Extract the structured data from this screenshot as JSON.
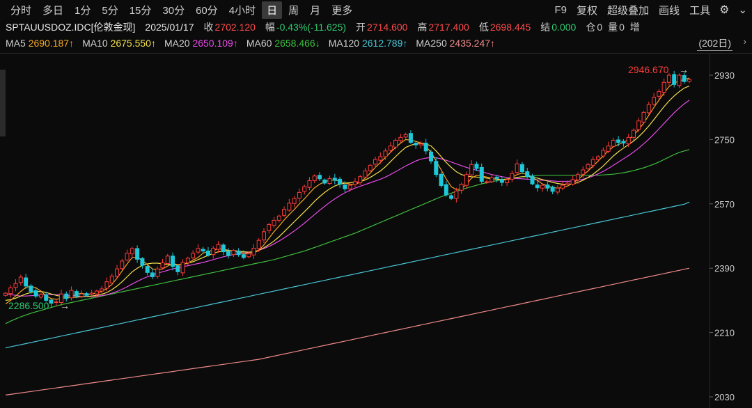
{
  "toolbar": {
    "periods": [
      "分时",
      "多日",
      "1分",
      "5分",
      "15分",
      "30分",
      "60分",
      "4小时",
      "日",
      "周",
      "月",
      "更多"
    ],
    "active_period": "日",
    "right_items": [
      "F9",
      "复权",
      "超级叠加",
      "画线",
      "工具"
    ],
    "settings_icon": "gear-icon"
  },
  "quote": {
    "symbol": "SPTAUUSDOZ.IDC[伦敦金现]",
    "date": "2025/01/17",
    "close_label": "收",
    "close": "2702.120",
    "change_label": "幅",
    "change": "-0.43%(-11.625)",
    "open_label": "开",
    "open": "2714.600",
    "high_label": "高",
    "high": "2717.400",
    "low_label": "低",
    "low": "2698.445",
    "settle_label": "结",
    "settle": "0.000",
    "oi_label": "仓",
    "oi": "0",
    "vol_label": "量",
    "vol": "0",
    "incr_label": "增"
  },
  "ma": {
    "items": [
      {
        "label": "MA5",
        "value": "2690.187↑",
        "color": "#f5a623"
      },
      {
        "label": "MA10",
        "value": "2675.550↑",
        "color": "#f4e04d"
      },
      {
        "label": "MA20",
        "value": "2650.109↑",
        "color": "#e84be8"
      },
      {
        "label": "MA60",
        "value": "2658.466↓",
        "color": "#3fbf3f"
      },
      {
        "label": "MA120",
        "value": "2612.789↑",
        "color": "#49c6d6"
      },
      {
        "label": "MA250",
        "value": "2435.247↑",
        "color": "#f08a8a"
      }
    ],
    "days_label": "(202日)"
  },
  "chart_data": {
    "type": "candlestick",
    "y_ticks": [
      2930,
      2750,
      2570,
      2390,
      2210,
      2030
    ],
    "ylim": [
      2030,
      2950
    ],
    "annotations": {
      "high": "2946.670",
      "low": "2286.500"
    },
    "colors": {
      "up": "#ff3b3b",
      "down": "#1ec8d8"
    },
    "closes": [
      2320,
      2335,
      2347,
      2365,
      2340,
      2325,
      2312,
      2316,
      2300,
      2292,
      2296,
      2318,
      2305,
      2328,
      2312,
      2318,
      2314,
      2320,
      2326,
      2332,
      2352,
      2368,
      2388,
      2410,
      2432,
      2445,
      2415,
      2398,
      2378,
      2366,
      2388,
      2405,
      2424,
      2395,
      2380,
      2406,
      2418,
      2432,
      2445,
      2438,
      2426,
      2446,
      2456,
      2436,
      2425,
      2440,
      2428,
      2420,
      2430,
      2446,
      2468,
      2492,
      2512,
      2524,
      2536,
      2555,
      2572,
      2585,
      2602,
      2618,
      2635,
      2648,
      2640,
      2628,
      2641,
      2636,
      2625,
      2612,
      2622,
      2632,
      2646,
      2662,
      2678,
      2694,
      2702,
      2718,
      2732,
      2748,
      2756,
      2764,
      2742,
      2735,
      2738,
      2718,
      2690,
      2652,
      2621,
      2595,
      2585,
      2606,
      2625,
      2652,
      2680,
      2669,
      2633,
      2632,
      2643,
      2641,
      2630,
      2638,
      2655,
      2682,
      2660,
      2646,
      2626,
      2615,
      2622,
      2614,
      2605,
      2614,
      2622,
      2628,
      2638,
      2652,
      2665,
      2680,
      2694,
      2702,
      2720,
      2732,
      2748,
      2742,
      2740,
      2756,
      2776,
      2802,
      2826,
      2848,
      2868,
      2884,
      2910,
      2930,
      2904,
      2930,
      2912,
      2918
    ],
    "ma5": [
      2290,
      2300,
      2312,
      2325,
      2336,
      2340,
      2335,
      2326,
      2312,
      2305,
      2303,
      2305,
      2308,
      2312,
      2317,
      2320,
      2316,
      2318,
      2321,
      2325,
      2333,
      2345,
      2362,
      2382,
      2402,
      2420,
      2420,
      2412,
      2400,
      2388,
      2385,
      2388,
      2396,
      2403,
      2400,
      2400,
      2405,
      2412,
      2420,
      2432,
      2437,
      2440,
      2444,
      2443,
      2440,
      2438,
      2436,
      2432,
      2430,
      2432,
      2440,
      2455,
      2474,
      2492,
      2508,
      2525,
      2540,
      2554,
      2570,
      2584,
      2600,
      2615,
      2625,
      2632,
      2636,
      2636,
      2634,
      2628,
      2625,
      2625,
      2630,
      2642,
      2656,
      2672,
      2686,
      2700,
      2714,
      2728,
      2740,
      2750,
      2748,
      2745,
      2740,
      2730,
      2715,
      2690,
      2665,
      2640,
      2618,
      2610,
      2612,
      2625,
      2642,
      2650,
      2648,
      2645,
      2642,
      2638,
      2636,
      2638,
      2644,
      2652,
      2656,
      2652,
      2645,
      2635,
      2626,
      2620,
      2616,
      2614,
      2616,
      2620,
      2628,
      2638,
      2650,
      2662,
      2676,
      2690,
      2704,
      2718,
      2730,
      2736,
      2742,
      2750,
      2762,
      2778,
      2796,
      2818,
      2840,
      2860,
      2880,
      2898,
      2908,
      2914,
      2918,
      2922
    ],
    "ma10": [
      2300,
      2302,
      2306,
      2312,
      2318,
      2322,
      2325,
      2325,
      2322,
      2318,
      2314,
      2311,
      2309,
      2308,
      2309,
      2310,
      2311,
      2312,
      2314,
      2317,
      2322,
      2330,
      2340,
      2352,
      2366,
      2380,
      2390,
      2398,
      2402,
      2404,
      2404,
      2402,
      2401,
      2400,
      2400,
      2401,
      2404,
      2408,
      2414,
      2420,
      2426,
      2431,
      2436,
      2438,
      2439,
      2439,
      2438,
      2436,
      2435,
      2436,
      2440,
      2447,
      2456,
      2466,
      2478,
      2492,
      2506,
      2520,
      2534,
      2548,
      2562,
      2577,
      2590,
      2602,
      2612,
      2620,
      2625,
      2628,
      2629,
      2630,
      2632,
      2637,
      2644,
      2653,
      2662,
      2674,
      2688,
      2702,
      2716,
      2728,
      2734,
      2738,
      2740,
      2738,
      2732,
      2718,
      2702,
      2686,
      2672,
      2660,
      2652,
      2648,
      2646,
      2645,
      2644,
      2642,
      2640,
      2639,
      2638,
      2639,
      2641,
      2644,
      2646,
      2646,
      2645,
      2642,
      2638,
      2634,
      2630,
      2627,
      2625,
      2624,
      2626,
      2630,
      2636,
      2644,
      2653,
      2664,
      2676,
      2690,
      2704,
      2716,
      2726,
      2736,
      2746,
      2758,
      2772,
      2788,
      2806,
      2824,
      2842,
      2858,
      2872,
      2884,
      2894,
      2900
    ],
    "ma20": [
      2318,
      2316,
      2314,
      2312,
      2312,
      2313,
      2314,
      2315,
      2316,
      2316,
      2316,
      2315,
      2314,
      2313,
      2312,
      2311,
      2311,
      2311,
      2312,
      2313,
      2316,
      2320,
      2325,
      2331,
      2338,
      2346,
      2353,
      2360,
      2366,
      2371,
      2376,
      2380,
      2384,
      2388,
      2391,
      2394,
      2397,
      2400,
      2403,
      2406,
      2410,
      2414,
      2418,
      2422,
      2425,
      2428,
      2430,
      2432,
      2434,
      2436,
      2440,
      2445,
      2451,
      2458,
      2466,
      2475,
      2484,
      2494,
      2505,
      2516,
      2528,
      2540,
      2552,
      2563,
      2574,
      2584,
      2593,
      2601,
      2608,
      2614,
      2619,
      2624,
      2629,
      2634,
      2639,
      2645,
      2652,
      2660,
      2668,
      2676,
      2683,
      2690,
      2695,
      2698,
      2700,
      2699,
      2696,
      2692,
      2687,
      2682,
      2677,
      2672,
      2668,
      2664,
      2660,
      2656,
      2652,
      2649,
      2646,
      2644,
      2642,
      2641,
      2640,
      2639,
      2638,
      2637,
      2636,
      2635,
      2634,
      2633,
      2633,
      2633,
      2634,
      2636,
      2639,
      2643,
      2648,
      2654,
      2661,
      2669,
      2678,
      2687,
      2696,
      2705,
      2715,
      2726,
      2738,
      2751,
      2765,
      2780,
      2795,
      2810,
      2825,
      2838,
      2850,
      2860
    ],
    "ma60": [
      2235,
      2242,
      2248,
      2254,
      2259,
      2264,
      2268,
      2272,
      2276,
      2280,
      2284,
      2288,
      2291,
      2294,
      2297,
      2300,
      2303,
      2306,
      2309,
      2312,
      2315,
      2318,
      2321,
      2324,
      2327,
      2330,
      2333,
      2336,
      2339,
      2342,
      2345,
      2348,
      2351,
      2354,
      2357,
      2360,
      2363,
      2366,
      2369,
      2372,
      2375,
      2378,
      2381,
      2384,
      2387,
      2390,
      2393,
      2396,
      2399,
      2402,
      2405,
      2408,
      2411,
      2414,
      2418,
      2422,
      2426,
      2430,
      2434,
      2438,
      2443,
      2448,
      2453,
      2458,
      2463,
      2468,
      2473,
      2478,
      2483,
      2488,
      2494,
      2500,
      2506,
      2512,
      2518,
      2524,
      2530,
      2536,
      2542,
      2548,
      2554,
      2560,
      2566,
      2572,
      2578,
      2584,
      2590,
      2595,
      2600,
      2605,
      2610,
      2614,
      2618,
      2622,
      2626,
      2629,
      2632,
      2635,
      2638,
      2640,
      2642,
      2644,
      2646,
      2647,
      2648,
      2649,
      2650,
      2650,
      2650,
      2650,
      2650,
      2650,
      2650,
      2650,
      2650,
      2650,
      2650,
      2650,
      2651,
      2652,
      2653,
      2655,
      2657,
      2660,
      2663,
      2667,
      2671,
      2676,
      2681,
      2687,
      2694,
      2701,
      2708,
      2714,
      2718,
      2722
    ],
    "ma120": [
      2167,
      2170,
      2173,
      2176,
      2179,
      2182,
      2185,
      2188,
      2191,
      2194,
      2197,
      2200,
      2203,
      2206,
      2209,
      2212,
      2215,
      2218,
      2221,
      2224,
      2227,
      2230,
      2233,
      2236,
      2239,
      2242,
      2245,
      2248,
      2251,
      2254,
      2257,
      2260,
      2263,
      2266,
      2269,
      2272,
      2275,
      2278,
      2281,
      2284,
      2287,
      2290,
      2293,
      2296,
      2299,
      2302,
      2305,
      2308,
      2311,
      2314,
      2317,
      2320,
      2323,
      2326,
      2329,
      2332,
      2335,
      2338,
      2341,
      2344,
      2347,
      2350,
      2353,
      2356,
      2359,
      2362,
      2365,
      2368,
      2371,
      2374,
      2377,
      2380,
      2383,
      2386,
      2389,
      2392,
      2395,
      2398,
      2401,
      2404,
      2407,
      2410,
      2413,
      2416,
      2419,
      2422,
      2425,
      2428,
      2431,
      2434,
      2437,
      2440,
      2443,
      2446,
      2449,
      2452,
      2455,
      2458,
      2461,
      2464,
      2467,
      2470,
      2473,
      2476,
      2479,
      2482,
      2485,
      2488,
      2491,
      2494,
      2497,
      2500,
      2503,
      2506,
      2509,
      2512,
      2515,
      2518,
      2521,
      2524,
      2527,
      2530,
      2533,
      2536,
      2539,
      2542,
      2545,
      2548,
      2551,
      2554,
      2557,
      2560,
      2563,
      2566,
      2569,
      2575
    ],
    "ma250": [
      2035,
      2037,
      2039,
      2041,
      2043,
      2045,
      2047,
      2049,
      2051,
      2053,
      2055,
      2057,
      2059,
      2061,
      2063,
      2065,
      2067,
      2069,
      2071,
      2073,
      2075,
      2077,
      2079,
      2081,
      2083,
      2085,
      2087,
      2089,
      2091,
      2093,
      2095,
      2097,
      2099,
      2101,
      2103,
      2105,
      2107,
      2109,
      2111,
      2113,
      2115,
      2117,
      2119,
      2121,
      2123,
      2125,
      2127,
      2129,
      2131,
      2133,
      2135,
      2138,
      2141,
      2144,
      2147,
      2150,
      2153,
      2156,
      2159,
      2162,
      2165,
      2168,
      2171,
      2174,
      2177,
      2180,
      2183,
      2186,
      2189,
      2192,
      2195,
      2198,
      2201,
      2204,
      2207,
      2210,
      2213,
      2216,
      2219,
      2222,
      2225,
      2228,
      2231,
      2234,
      2237,
      2240,
      2243,
      2246,
      2249,
      2252,
      2255,
      2258,
      2261,
      2264,
      2267,
      2270,
      2273,
      2276,
      2279,
      2282,
      2285,
      2288,
      2291,
      2294,
      2297,
      2300,
      2303,
      2306,
      2309,
      2312,
      2315,
      2318,
      2321,
      2324,
      2327,
      2330,
      2333,
      2336,
      2339,
      2342,
      2345,
      2348,
      2351,
      2354,
      2357,
      2360,
      2363,
      2366,
      2369,
      2372,
      2375,
      2378,
      2381,
      2384,
      2387,
      2390
    ]
  }
}
